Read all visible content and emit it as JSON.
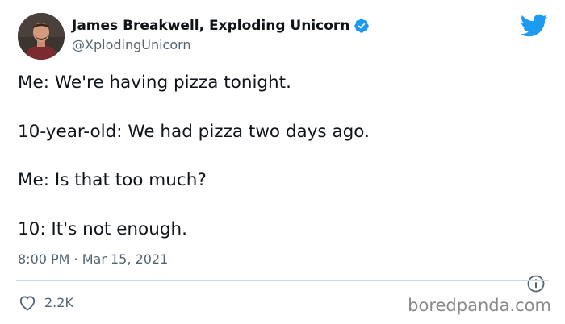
{
  "author": {
    "display_name": "James Breakwell, Exploding Unicorn",
    "handle": "@XplodingUnicorn",
    "verified": true
  },
  "tweet": {
    "lines": [
      "Me: We're having pizza tonight.",
      "10-year-old: We had pizza two days ago.",
      "Me: Is that too much?",
      "10: It's not enough."
    ],
    "timestamp": "8:00 PM · Mar 15, 2021"
  },
  "actions": {
    "like_count": "2.2K"
  },
  "watermark": "boredpanda.com",
  "icons": {
    "brand": "twitter-bird-icon",
    "verified": "verified-badge-icon",
    "info": "info-icon",
    "like": "heart-icon"
  },
  "colors": {
    "twitter_blue": "#1d9bf0",
    "text_primary": "#0f1419",
    "text_secondary": "#536471",
    "divider": "#cfd9de",
    "watermark": "#8a8a8a"
  }
}
